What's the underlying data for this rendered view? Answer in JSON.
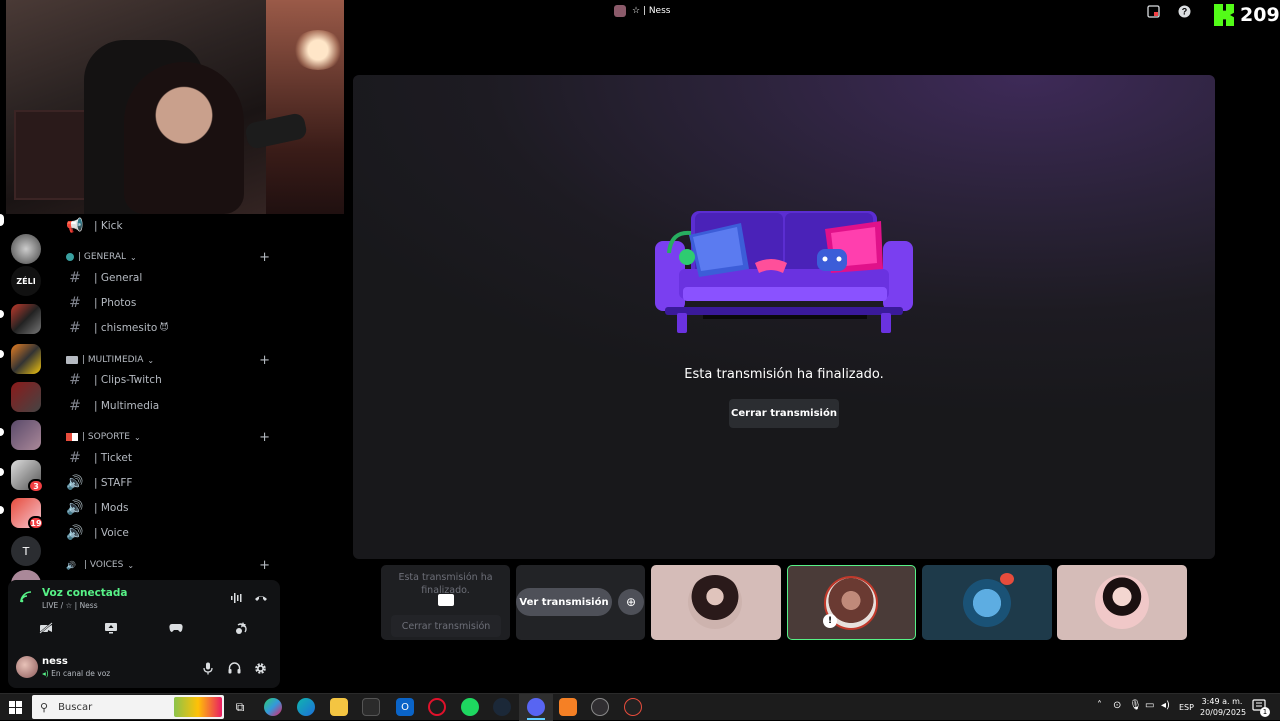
{
  "header": {
    "channel_title": "☆ | Ness",
    "kick_count": "209"
  },
  "channels": {
    "items": [
      {
        "type": "voice",
        "label": "| Kick"
      },
      {
        "type": "category",
        "label": "| GENERAL"
      },
      {
        "type": "text",
        "label": "| General"
      },
      {
        "type": "text",
        "label": "| Photos"
      },
      {
        "type": "text",
        "label": "| chismesito"
      },
      {
        "type": "category",
        "label": "| MULTIMEDIA"
      },
      {
        "type": "text",
        "label": "| Clips-Twitch"
      },
      {
        "type": "text",
        "label": "| Multimedia"
      },
      {
        "type": "category",
        "label": "| SOPORTE"
      },
      {
        "type": "text",
        "label": "| Ticket"
      },
      {
        "type": "voice",
        "label": "| STAFF"
      },
      {
        "type": "voice",
        "label": "| Mods"
      },
      {
        "type": "voice",
        "label": "| Voice"
      },
      {
        "type": "category",
        "label": "| VOICES"
      }
    ],
    "chismesito_emoji": "😈"
  },
  "servers": {
    "badge_3": "3",
    "badge_19": "19",
    "zeli_label": "ZÉLI",
    "t_label": "T"
  },
  "voice_panel": {
    "status": "Voz conectada",
    "channel": "LIVE / ☆ | Ness"
  },
  "user": {
    "name": "ness",
    "status": "En canal de voz"
  },
  "stage": {
    "message": "Esta transmisión ha finalizado.",
    "close_label": "Cerrar transmisión"
  },
  "tiles": {
    "ended_message": "Esta transmisión ha finalizado.",
    "ended_close_label": "Cerrar transmisión",
    "watch_label": "Ver transmisión"
  },
  "taskbar": {
    "search_placeholder": "Buscar",
    "language": "ESP",
    "time": "3:49 a. m.",
    "date": "20/09/2025",
    "notification_count": "1"
  },
  "colors": {
    "accent_green": "#57f287",
    "kick_green": "#53fc18",
    "badge_red": "#f23f43",
    "stage_purple": "#3e2a58"
  }
}
